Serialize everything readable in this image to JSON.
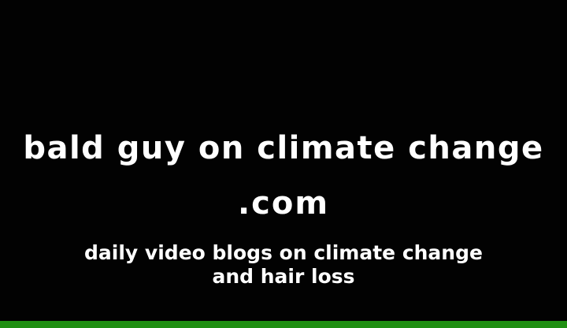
{
  "title": {
    "line1": "bald guy on climate change",
    "line2": ".com"
  },
  "subtitle": {
    "line1": "daily video blogs on climate change",
    "line2": "and hair loss"
  },
  "colors": {
    "background": "#000000",
    "text": "#ffffff",
    "bottom_bar": "#1f8f12"
  }
}
